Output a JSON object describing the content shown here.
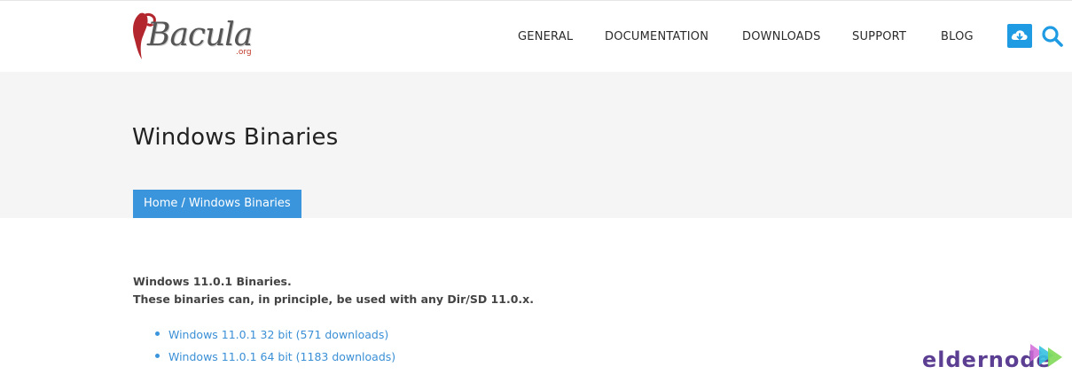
{
  "logo": {
    "word": "Bacula",
    "sub": ".org"
  },
  "nav": [
    {
      "label": "GENERAL"
    },
    {
      "label": "DOCUMENTATION"
    },
    {
      "label": "DOWNLOADS"
    },
    {
      "label": "SUPPORT"
    },
    {
      "label": "BLOG"
    }
  ],
  "header_icons": {
    "download": "cloud-download-icon",
    "search": "search-icon"
  },
  "page": {
    "title": "Windows Binaries"
  },
  "breadcrumb": {
    "home": "Home",
    "separator": " / ",
    "current": "Windows Binaries"
  },
  "content": {
    "line1": "Windows 11.0.1 Binaries.",
    "line2": "These binaries can, in principle, be used with any Dir/SD 11.0.x.",
    "links": [
      {
        "label": "Windows 11.0.1 32 bit (571 downloads)"
      },
      {
        "label": "Windows 11.0.1 64 bit (1183 downloads)"
      }
    ]
  },
  "watermark": {
    "text": "eldernode"
  },
  "colors": {
    "accent": "#3b95dc",
    "download_button": "#1e9be3",
    "link": "#3a8fd6",
    "banner_bg": "#f5f5f5",
    "logo_red": "#c0392b"
  }
}
